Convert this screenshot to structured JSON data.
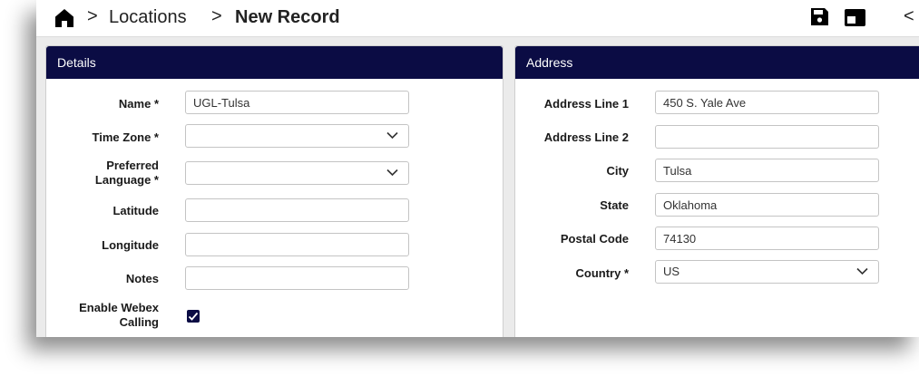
{
  "breadcrumb": {
    "items": [
      "Locations",
      "New Record"
    ],
    "separator": ">"
  },
  "toolbar": {
    "icons": [
      "home-icon",
      "save-icon",
      "panel-icon",
      "collapse-chevron-icon"
    ],
    "partial_glyph": "<"
  },
  "colors": {
    "panel_header": "#0b0c44",
    "checkbox": "#0b0c44",
    "background": "#ebebeb"
  },
  "details": {
    "title": "Details",
    "name": {
      "label": "Name *",
      "value": "UGL-Tulsa"
    },
    "time_zone": {
      "label": "Time Zone *",
      "value": ""
    },
    "preferred_language": {
      "label_line1": "Preferred",
      "label_line2": "Language *",
      "value": ""
    },
    "latitude": {
      "label": "Latitude",
      "value": ""
    },
    "longitude": {
      "label": "Longitude",
      "value": ""
    },
    "notes": {
      "label": "Notes",
      "value": ""
    },
    "enable_webex": {
      "label_line1": "Enable Webex",
      "label_line2": "Calling",
      "checked": true
    }
  },
  "address": {
    "title": "Address",
    "line1": {
      "label": "Address Line 1",
      "value": "450 S. Yale Ave"
    },
    "line2": {
      "label": "Address Line 2",
      "value": ""
    },
    "city": {
      "label": "City",
      "value": "Tulsa"
    },
    "state": {
      "label": "State",
      "value": "Oklahoma"
    },
    "postal_code": {
      "label": "Postal Code",
      "value": "74130"
    },
    "country": {
      "label": "Country *",
      "value": "US"
    }
  }
}
